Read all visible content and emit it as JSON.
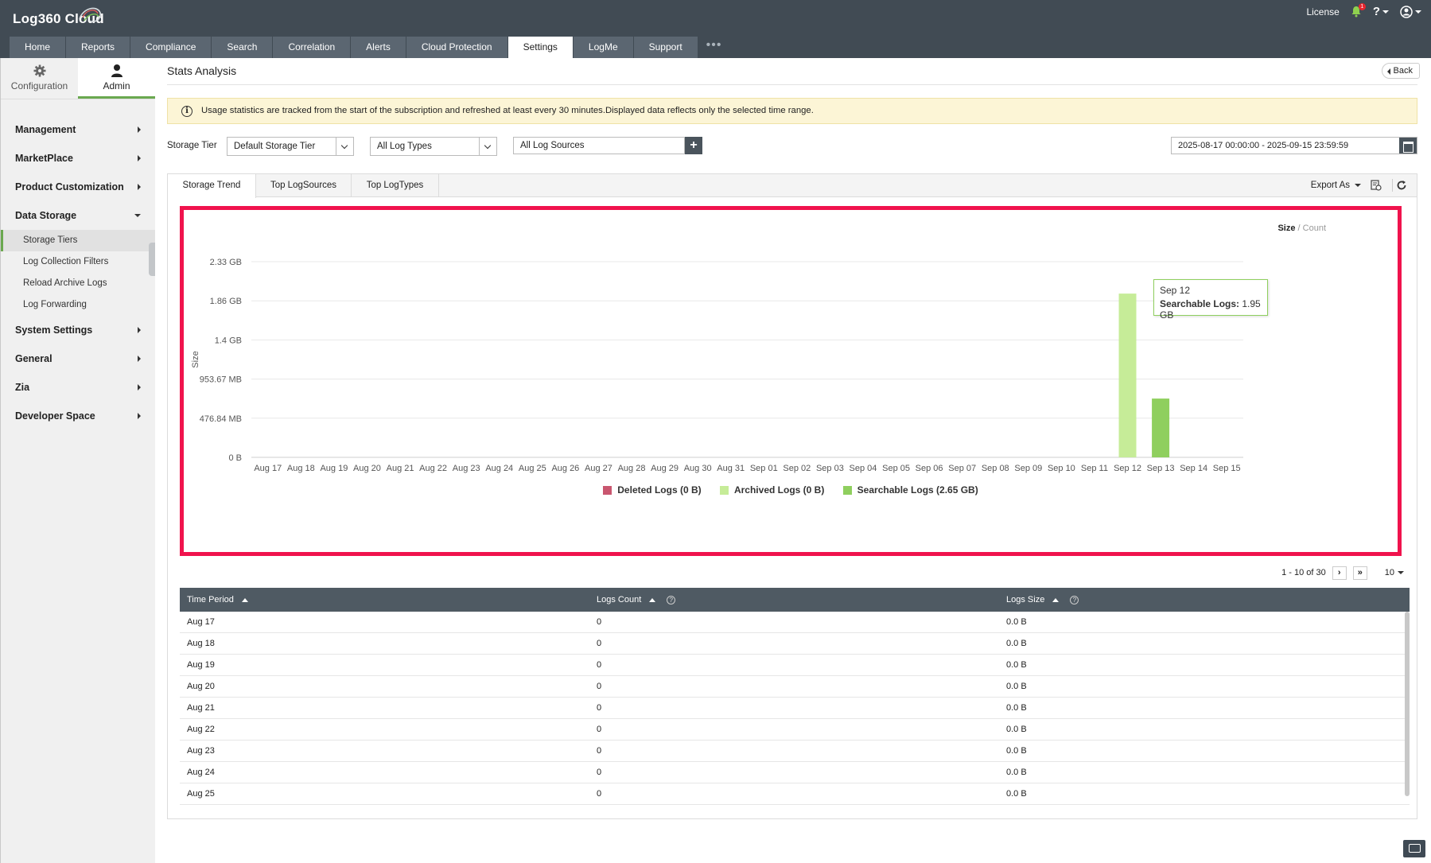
{
  "app": {
    "logo": "Log360 Cloud",
    "license": "License",
    "notification_count": "1",
    "help": "?"
  },
  "nav_tabs": [
    "Home",
    "Reports",
    "Compliance",
    "Search",
    "Correlation",
    "Alerts",
    "Cloud Protection",
    "Settings",
    "LogMe",
    "Support"
  ],
  "nav_active": "Settings",
  "sidebar": {
    "switch": {
      "configuration": "Configuration",
      "admin": "Admin"
    },
    "menu": [
      {
        "label": "Management"
      },
      {
        "label": "MarketPlace"
      },
      {
        "label": "Product Customization"
      },
      {
        "label": "Data Storage",
        "expanded": true,
        "children": [
          "Storage Tiers",
          "Log Collection Filters",
          "Reload Archive Logs",
          "Log Forwarding"
        ]
      },
      {
        "label": "System Settings"
      },
      {
        "label": "General"
      },
      {
        "label": "Zia"
      },
      {
        "label": "Developer Space"
      }
    ]
  },
  "page": {
    "title": "Stats Analysis",
    "back": "Back",
    "info": "Usage statistics are tracked from the start of the subscription and refreshed at least every 30 minutes.Displayed data reflects only the selected time range."
  },
  "filters": {
    "storage_tier_label": "Storage Tier",
    "storage_tier_value": "Default Storage Tier",
    "log_types_value": "All Log Types",
    "log_sources_value": "All Log Sources",
    "date_range": "2025-08-17 00:00:00 - 2025-09-15 23:59:59"
  },
  "tabs": {
    "trend": "Storage Trend",
    "sources": "Top LogSources",
    "types": "Top LogTypes",
    "export": "Export As"
  },
  "toggle": {
    "size": "Size",
    "sep": " / ",
    "count": "Count"
  },
  "colors": {
    "deleted": "#c9566f",
    "archived": "#c6ec98",
    "searchable": "#8fcf5e",
    "highlight": "#f0134d"
  },
  "chart_data": {
    "type": "bar",
    "ylabel": "Size",
    "y_ticks": [
      "0 B",
      "476.84 MB",
      "953.67 MB",
      "1.4 GB",
      "1.86 GB",
      "2.33 GB"
    ],
    "ylim_gb": [
      0,
      2.33
    ],
    "categories": [
      "Aug 17",
      "Aug 18",
      "Aug 19",
      "Aug 20",
      "Aug 21",
      "Aug 22",
      "Aug 23",
      "Aug 24",
      "Aug 25",
      "Aug 26",
      "Aug 27",
      "Aug 28",
      "Aug 29",
      "Aug 30",
      "Aug 31",
      "Sep 01",
      "Sep 02",
      "Sep 03",
      "Sep 04",
      "Sep 05",
      "Sep 06",
      "Sep 07",
      "Sep 08",
      "Sep 09",
      "Sep 10",
      "Sep 11",
      "Sep 12",
      "Sep 13",
      "Sep 14",
      "Sep 15"
    ],
    "series": [
      {
        "name": "Deleted Logs",
        "legend": "Deleted Logs (0 B)",
        "values": [
          0,
          0,
          0,
          0,
          0,
          0,
          0,
          0,
          0,
          0,
          0,
          0,
          0,
          0,
          0,
          0,
          0,
          0,
          0,
          0,
          0,
          0,
          0,
          0,
          0,
          0,
          0,
          0,
          0,
          0
        ]
      },
      {
        "name": "Archived Logs",
        "legend": "Archived Logs (0 B)",
        "values": [
          0,
          0,
          0,
          0,
          0,
          0,
          0,
          0,
          0,
          0,
          0,
          0,
          0,
          0,
          0,
          0,
          0,
          0,
          0,
          0,
          0,
          0,
          0,
          0,
          0,
          0,
          0,
          0,
          0,
          0
        ]
      },
      {
        "name": "Searchable Logs",
        "legend": "Searchable Logs (2.65 GB)",
        "values": [
          0,
          0,
          0,
          0,
          0,
          0,
          0,
          0,
          0,
          0,
          0,
          0,
          0,
          0,
          0,
          0,
          0,
          0,
          0,
          0,
          0,
          0,
          0,
          0,
          0,
          0,
          1.95,
          0.7,
          0,
          0
        ]
      }
    ],
    "tooltip": {
      "title": "Sep 12",
      "label": "Searchable Logs:",
      "value": "1.95 GB"
    }
  },
  "pagination": {
    "range": "1 - 10 of 30",
    "per_page": "10"
  },
  "table": {
    "columns": [
      "Time Period",
      "Logs Count",
      "Logs Size"
    ],
    "rows": [
      [
        "Aug 17",
        "0",
        "0.0 B"
      ],
      [
        "Aug 18",
        "0",
        "0.0 B"
      ],
      [
        "Aug 19",
        "0",
        "0.0 B"
      ],
      [
        "Aug 20",
        "0",
        "0.0 B"
      ],
      [
        "Aug 21",
        "0",
        "0.0 B"
      ],
      [
        "Aug 22",
        "0",
        "0.0 B"
      ],
      [
        "Aug 23",
        "0",
        "0.0 B"
      ],
      [
        "Aug 24",
        "0",
        "0.0 B"
      ],
      [
        "Aug 25",
        "0",
        "0.0 B"
      ]
    ]
  }
}
